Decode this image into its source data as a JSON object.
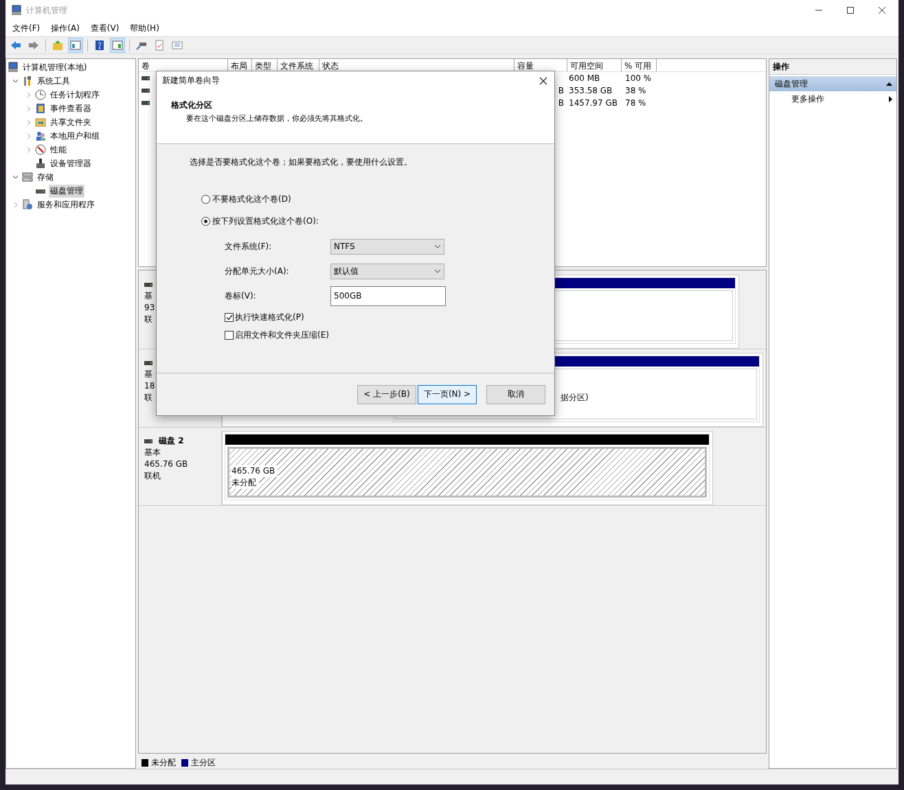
{
  "window": {
    "title": "计算机管理"
  },
  "menu": [
    "文件(F)",
    "操作(A)",
    "查看(V)",
    "帮助(H)"
  ],
  "toolbar": [
    {
      "pressed": false
    },
    {
      "pressed": false
    },
    {
      "pressed": false
    },
    {
      "pressed": true
    },
    {
      "pressed": false
    },
    {
      "pressed": true
    },
    {
      "pressed": false
    },
    {
      "pressed": false
    },
    {
      "pressed": false
    }
  ],
  "tree": [
    {
      "label": "计算机管理(本地)",
      "selected": false,
      "children": [
        {
          "label": "系统工具",
          "expandable": true,
          "expanded": true,
          "selected": false,
          "children": [
            {
              "label": "任务计划程序",
              "expandable": true,
              "expanded": false,
              "selected": false
            },
            {
              "label": "事件查看器",
              "expandable": true,
              "expanded": false,
              "selected": false
            },
            {
              "label": "共享文件夹",
              "expandable": true,
              "expanded": false,
              "selected": false
            },
            {
              "label": "本地用户和组",
              "expandable": true,
              "expanded": false,
              "selected": false
            },
            {
              "label": "性能",
              "expandable": true,
              "expanded": false,
              "selected": false
            },
            {
              "label": "设备管理器",
              "expandable": false,
              "selected": false
            }
          ]
        },
        {
          "label": "存储",
          "expandable": true,
          "expanded": true,
          "selected": false,
          "children": [
            {
              "label": "磁盘管理",
              "expandable": false,
              "selected": true
            }
          ]
        },
        {
          "label": "服务和应用程序",
          "expandable": true,
          "expanded": false,
          "selected": false
        }
      ]
    }
  ],
  "table": {
    "columns": [
      "卷",
      "布局",
      "类型",
      "文件系统",
      "状态",
      "容量",
      "可用空间",
      "% 可用"
    ],
    "rows": [
      {
        "free": "600 MB",
        "percent": "100 %"
      },
      {
        "capacity": "B",
        "free": "353.58 GB",
        "percent": "38 %"
      },
      {
        "capacity": "B",
        "free": "1457.97 GB",
        "percent": "78 %"
      }
    ]
  },
  "disks": [
    {
      "type": "基",
      "size": "93",
      "status": "联",
      "partitions": [
        {
          "color": "#000080"
        }
      ]
    },
    {
      "type": "基",
      "size": "18",
      "status": "联",
      "partitions": [
        {
          "color": "#000080",
          "label": "据分区)"
        }
      ]
    },
    {
      "name": "磁盘 2",
      "type": "基本",
      "size": "465.76 GB",
      "status": "联机",
      "partitions": [
        {
          "color": "#000000",
          "size": "465.76 GB",
          "label": "未分配",
          "hatched": true
        }
      ]
    }
  ],
  "legend": [
    {
      "color": "#000000",
      "label": "未分配"
    },
    {
      "color": "#000080",
      "label": "主分区"
    }
  ],
  "actions": {
    "title": "操作",
    "section": "磁盘管理",
    "items": [
      "更多操作"
    ]
  },
  "dialog": {
    "title": "新建简单卷向导",
    "heading": "格式化分区",
    "subheading": "要在这个磁盘分区上储存数据，你必须先将其格式化。",
    "prompt": "选择是否要格式化这个卷；如果要格式化，要使用什么设置。",
    "radios": [
      {
        "label": "不要格式化这个卷(D)",
        "selected": false
      },
      {
        "label": "按下列设置格式化这个卷(O):",
        "selected": true
      }
    ],
    "fields": [
      {
        "kind": "dropdown",
        "label": "文件系统(F):",
        "value": "NTFS"
      },
      {
        "kind": "dropdown",
        "label": "分配单元大小(A):",
        "value": "默认值"
      },
      {
        "kind": "text",
        "label": "卷标(V):",
        "value": "500GB"
      }
    ],
    "checkboxes": [
      {
        "label": "执行快速格式化(P)",
        "checked": true
      },
      {
        "label": "启用文件和文件夹压缩(E)",
        "checked": false
      }
    ],
    "buttons": [
      {
        "label": "< 上一步(B)",
        "default": false
      },
      {
        "label": "下一页(N) >",
        "default": true
      },
      {
        "label": "取消",
        "default": false
      }
    ]
  }
}
